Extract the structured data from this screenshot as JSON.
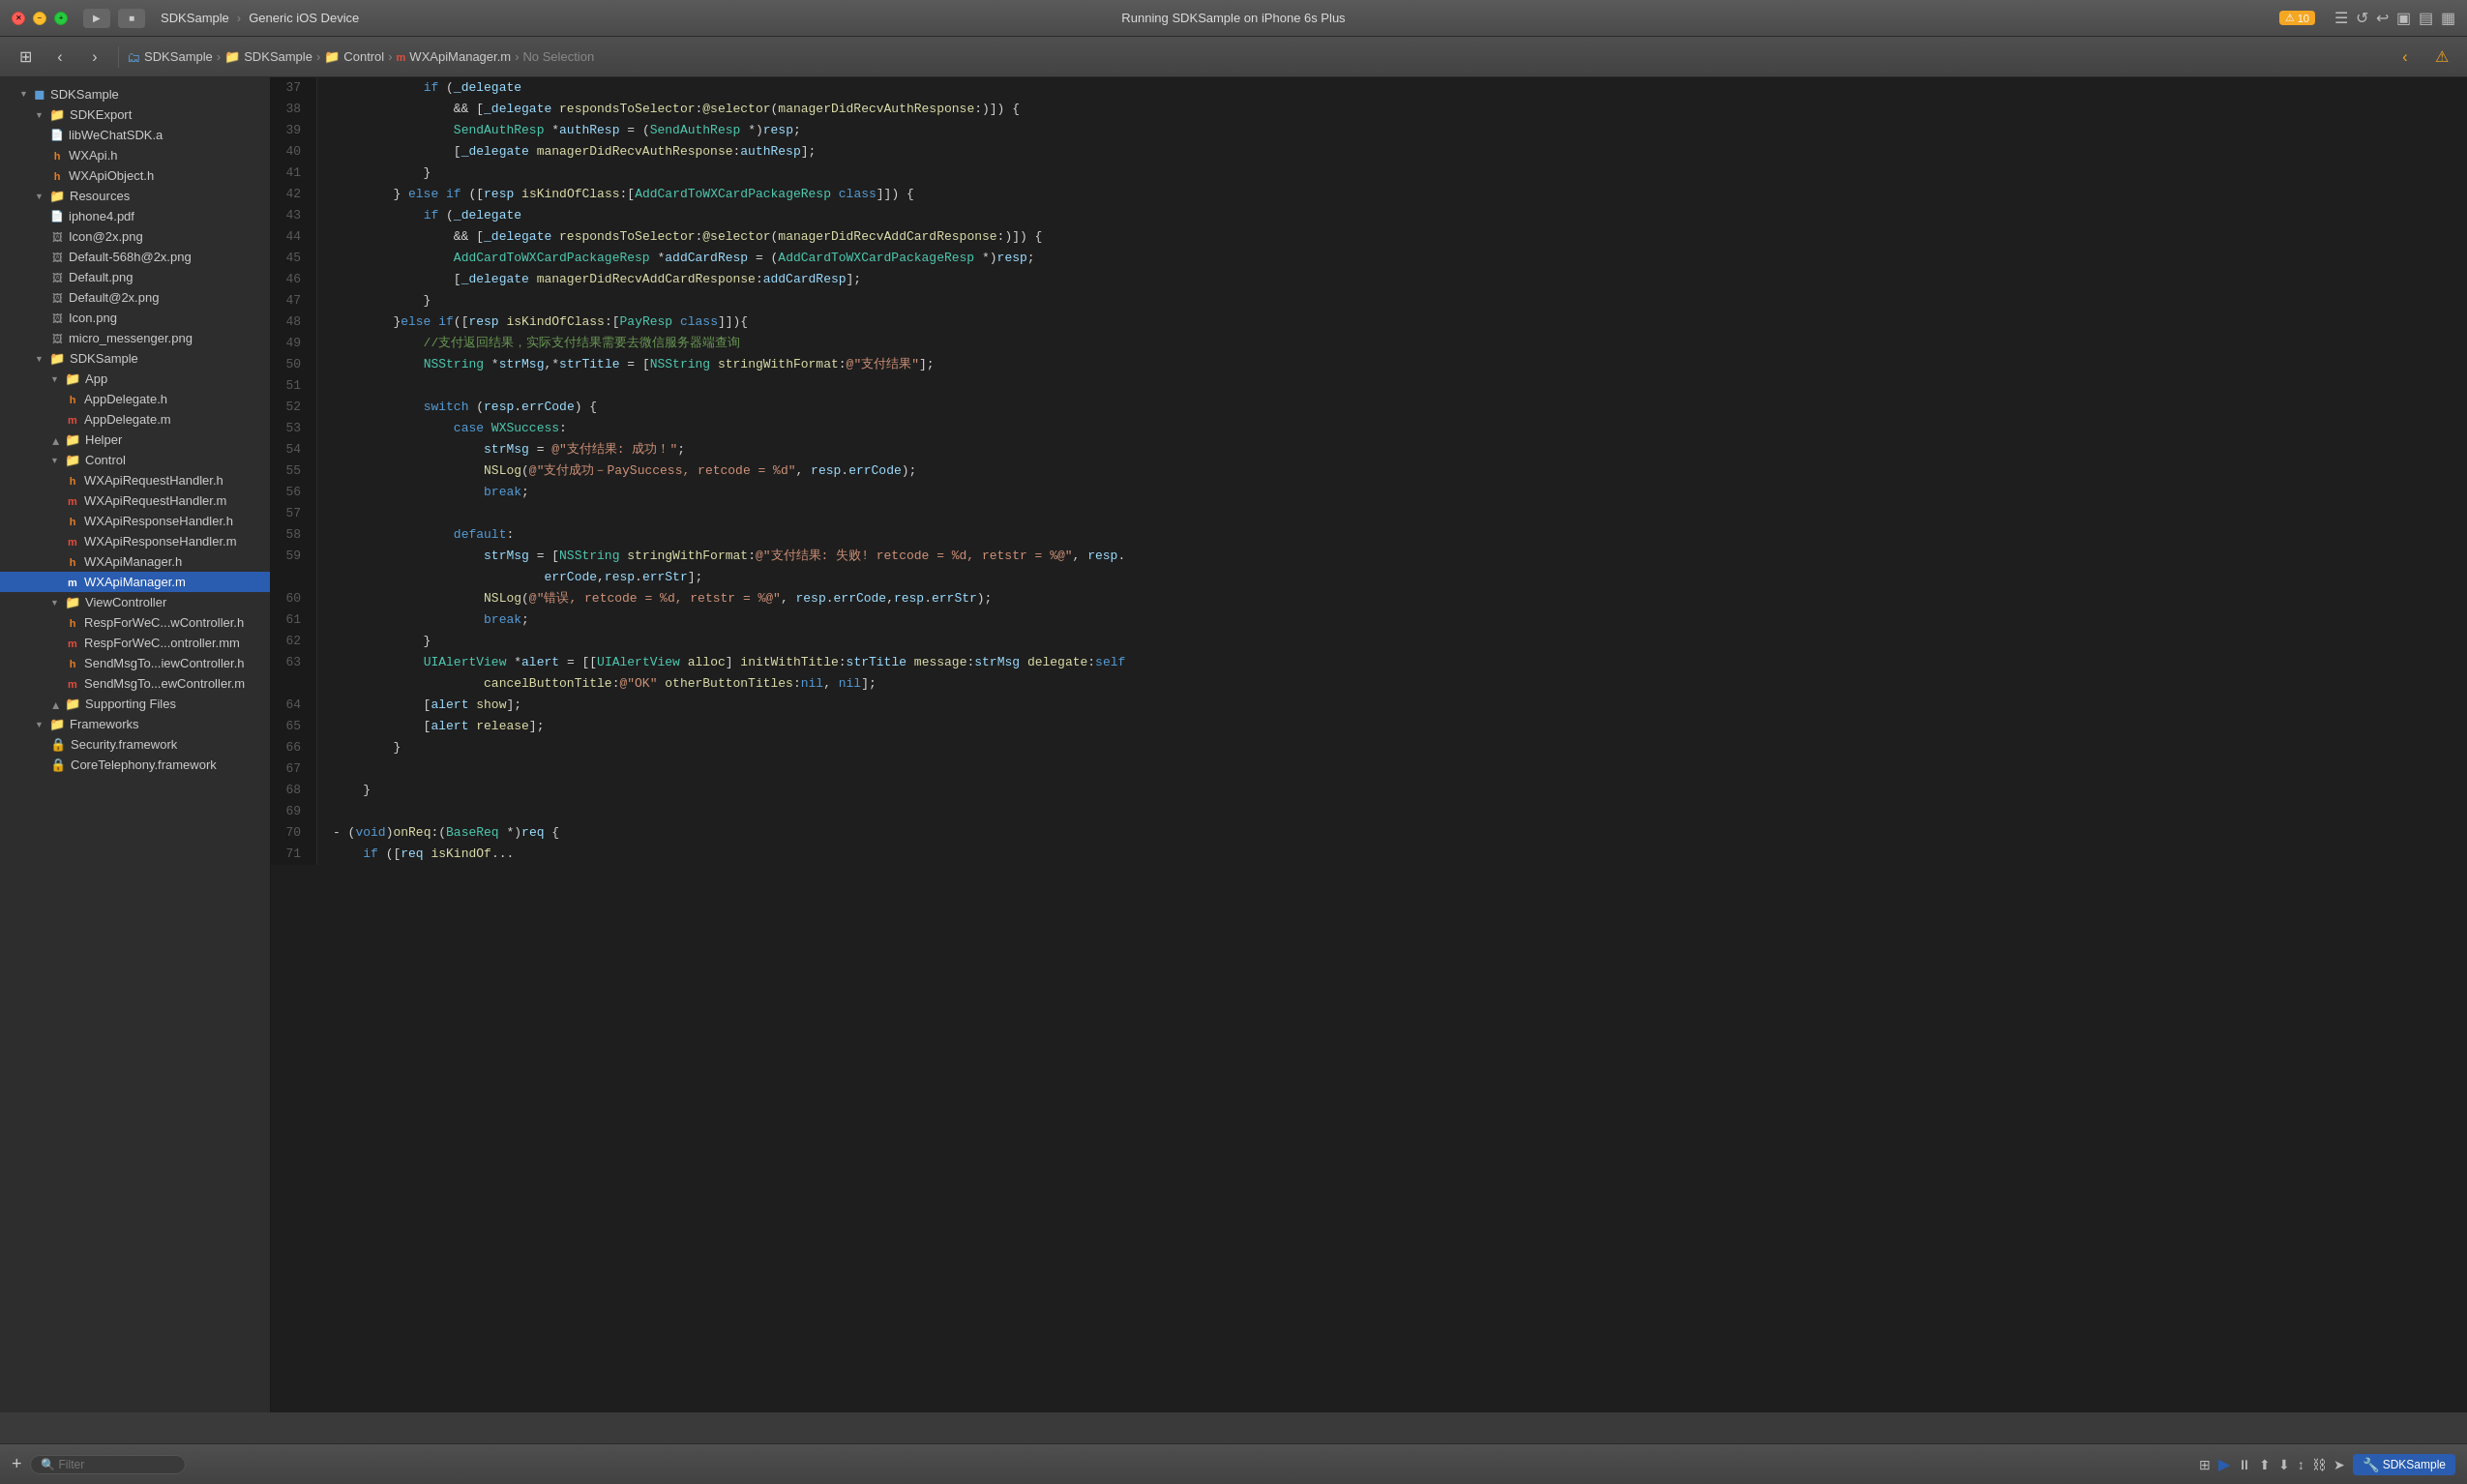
{
  "titlebar": {
    "app_name": "SDKSample",
    "device": "Generic iOS Device",
    "run_status": "Running SDKSample on iPhone 6s Plus",
    "warning_count": "10",
    "traffic_lights": [
      "close",
      "minimize",
      "maximize"
    ]
  },
  "toolbar": {
    "buttons": [
      "run",
      "stop",
      "scheme",
      "back",
      "forward",
      "grid",
      "warning"
    ]
  },
  "breadcrumb": {
    "items": [
      "SDKSample",
      "SDKSample",
      "Control",
      "WXApiManager.m"
    ],
    "selection": "No Selection"
  },
  "sidebar": {
    "items": [
      {
        "id": "sdksample-root",
        "label": "SDKSample",
        "type": "project",
        "level": 0,
        "expanded": true
      },
      {
        "id": "sdkexport",
        "label": "SDKExport",
        "type": "folder-yellow",
        "level": 1,
        "expanded": true
      },
      {
        "id": "libwechatsdk",
        "label": "libWeChatSDK.a",
        "type": "file",
        "level": 2
      },
      {
        "id": "wxapi-h",
        "label": "WXApi.h",
        "type": "file-h",
        "level": 2
      },
      {
        "id": "wxapiobject-h",
        "label": "WXApiObject.h",
        "type": "file-h",
        "level": 2
      },
      {
        "id": "resources",
        "label": "Resources",
        "type": "folder-yellow",
        "level": 1,
        "expanded": true
      },
      {
        "id": "iphone4-pdf",
        "label": "iphone4.pdf",
        "type": "file",
        "level": 2
      },
      {
        "id": "icon2x-png",
        "label": "Icon@2x.png",
        "type": "file",
        "level": 2
      },
      {
        "id": "default568-png",
        "label": "Default-568h@2x.png",
        "type": "file",
        "level": 2
      },
      {
        "id": "default-png",
        "label": "Default.png",
        "type": "file",
        "level": 2
      },
      {
        "id": "default2x-png",
        "label": "Default@2x.png",
        "type": "file",
        "level": 2
      },
      {
        "id": "icon-png",
        "label": "Icon.png",
        "type": "file",
        "level": 2
      },
      {
        "id": "micro-messenger-png",
        "label": "micro_messenger.png",
        "type": "file",
        "level": 2
      },
      {
        "id": "sdksample-group",
        "label": "SDKSample",
        "type": "folder-yellow",
        "level": 1,
        "expanded": true
      },
      {
        "id": "app-group",
        "label": "App",
        "type": "folder-yellow",
        "level": 2,
        "expanded": true
      },
      {
        "id": "appdelegate-h",
        "label": "AppDelegate.h",
        "type": "file-h",
        "level": 3
      },
      {
        "id": "appdelegate-m",
        "label": "AppDelegate.m",
        "type": "file-m",
        "level": 3
      },
      {
        "id": "helper-group",
        "label": "Helper",
        "type": "folder-yellow",
        "level": 2,
        "expanded": false
      },
      {
        "id": "control-group",
        "label": "Control",
        "type": "folder-yellow",
        "level": 2,
        "expanded": true
      },
      {
        "id": "wxapi-req-h",
        "label": "WXApiRequestHandler.h",
        "type": "file-h",
        "level": 3
      },
      {
        "id": "wxapi-req-m",
        "label": "WXApiRequestHandler.m",
        "type": "file-m",
        "level": 3
      },
      {
        "id": "wxapi-resp-h",
        "label": "WXApiResponseHandler.h",
        "type": "file-h",
        "level": 3
      },
      {
        "id": "wxapi-resp-m",
        "label": "WXApiResponseHandler.m",
        "type": "file-m",
        "level": 3
      },
      {
        "id": "wxapimanager-h",
        "label": "WXApiManager.h",
        "type": "file-h",
        "level": 3
      },
      {
        "id": "wxapimanager-m",
        "label": "WXApiManager.m",
        "type": "file-m-selected",
        "level": 3,
        "selected": true
      },
      {
        "id": "viewcontroller-group",
        "label": "ViewController",
        "type": "folder-yellow",
        "level": 2,
        "expanded": true
      },
      {
        "id": "respforwec-h",
        "label": "RespForWeC...wController.h",
        "type": "file-h",
        "level": 3
      },
      {
        "id": "respforwec-mm",
        "label": "RespForWeC...ontroller.mm",
        "type": "file-m",
        "level": 3
      },
      {
        "id": "sendmsgto-h",
        "label": "SendMsgTo...iewController.h",
        "type": "file-h",
        "level": 3
      },
      {
        "id": "sendmsgto-m",
        "label": "SendMsgTo...ewController.m",
        "type": "file-m",
        "level": 3
      },
      {
        "id": "supporting-files",
        "label": "Supporting Files",
        "type": "folder-yellow",
        "level": 2,
        "expanded": false
      },
      {
        "id": "frameworks",
        "label": "Frameworks",
        "type": "folder-yellow",
        "level": 1,
        "expanded": true
      },
      {
        "id": "security-fw",
        "label": "Security.framework",
        "type": "folder-lock",
        "level": 2
      },
      {
        "id": "core-telephony-fw",
        "label": "CoreTelephony.framework",
        "type": "folder-lock",
        "level": 2
      }
    ]
  },
  "editor": {
    "filename": "WXApiManager.m",
    "lines": [
      {
        "num": "37",
        "content": "            if (_delegate"
      },
      {
        "num": "38",
        "content": "                && [_delegate respondsToSelector:@selector(managerDidRecvAuthResponse:)]) {"
      },
      {
        "num": "39",
        "content": "                SendAuthResp *authResp = (SendAuthResp *)resp;"
      },
      {
        "num": "40",
        "content": "                [_delegate managerDidRecvAuthResponse:authResp];"
      },
      {
        "num": "41",
        "content": "            }"
      },
      {
        "num": "42",
        "content": "        } else if ([resp isKindOfClass:[AddCardToWXCardPackageResp class]]) {"
      },
      {
        "num": "43",
        "content": "            if (_delegate"
      },
      {
        "num": "44",
        "content": "                && [_delegate respondsToSelector:@selector(managerDidRecvAddCardResponse:)]) {"
      },
      {
        "num": "45",
        "content": "                AddCardToWXCardPackageResp *addCardResp = (AddCardToWXCardPackageResp *)resp;"
      },
      {
        "num": "46",
        "content": "                [_delegate managerDidRecvAddCardResponse:addCardResp];"
      },
      {
        "num": "47",
        "content": "            }"
      },
      {
        "num": "48",
        "content": "        }else if([resp isKindOfClass:[PayResp class]]){"
      },
      {
        "num": "49",
        "content": "            //支付返回结果，实际支付结果需要去微信服务器端查询"
      },
      {
        "num": "50",
        "content": "            NSString *strMsg,*strTitle = [NSString stringWithFormat:@\"支付结果\"];"
      },
      {
        "num": "51",
        "content": ""
      },
      {
        "num": "52",
        "content": "            switch (resp.errCode) {"
      },
      {
        "num": "53",
        "content": "                case WXSuccess:"
      },
      {
        "num": "54",
        "content": "                    strMsg = @\"支付结果: 成功！\";"
      },
      {
        "num": "55",
        "content": "                    NSLog(@\"支付成功-PaySuccess, retcode = %d\", resp.errCode);"
      },
      {
        "num": "56",
        "content": "                    break;"
      },
      {
        "num": "57",
        "content": ""
      },
      {
        "num": "58",
        "content": "                default:"
      },
      {
        "num": "59",
        "content": "                    strMsg = [NSString stringWithFormat:@\"支付结果: 失败! retcode = %d, retstr = %@\", resp."
      },
      {
        "num": "",
        "content": "                            errCode,resp.errStr];"
      },
      {
        "num": "60",
        "content": "                    NSLog(@\"错误, retcode = %d, retstr = %@\", resp.errCode,resp.errStr);"
      },
      {
        "num": "61",
        "content": "                    break;"
      },
      {
        "num": "62",
        "content": "            }"
      },
      {
        "num": "63",
        "content": "            UIAlertView *alert = [[UIAlertView alloc] initWithTitle:strTitle message:strMsg delegate:self"
      },
      {
        "num": "",
        "content": "                    cancelButtonTitle:@\"OK\" otherButtonTitles:nil, nil];"
      },
      {
        "num": "64",
        "content": "            [alert show];"
      },
      {
        "num": "65",
        "content": "            [alert release];"
      },
      {
        "num": "66",
        "content": "        }"
      },
      {
        "num": "67",
        "content": ""
      },
      {
        "num": "68",
        "content": "    }"
      },
      {
        "num": "69",
        "content": ""
      },
      {
        "num": "70",
        "content": "- (void)onReq:(BaseReq *)req {"
      },
      {
        "num": "71",
        "content": "    if ([req isKindOf..."
      }
    ]
  },
  "bottom_bar": {
    "filter_placeholder": "Filter",
    "scheme_name": "SDKSample",
    "add_button": "+",
    "icons": [
      "grid",
      "play",
      "pause",
      "up",
      "down",
      "up-down",
      "chain",
      "arrow",
      "sdk-icon"
    ]
  }
}
